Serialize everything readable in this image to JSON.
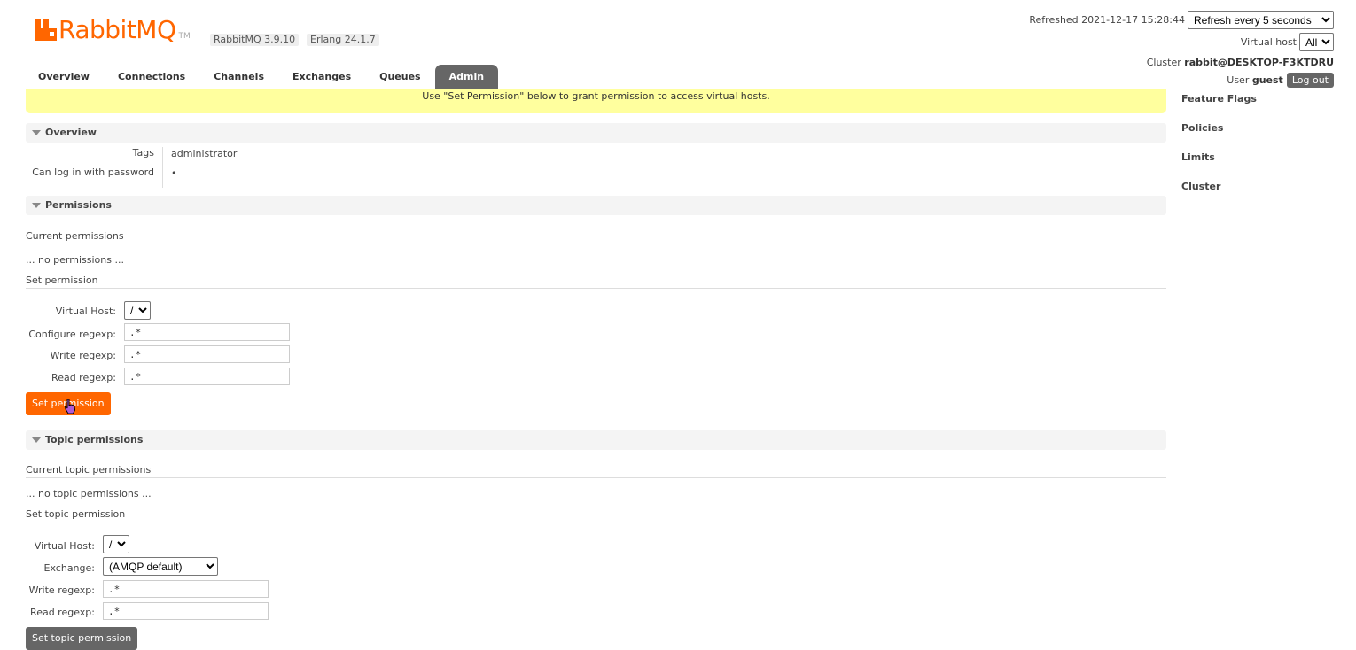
{
  "brand": {
    "logo_text": "RabbitMQ",
    "tm": "TM",
    "version": "RabbitMQ 3.9.10",
    "erlang": "Erlang 24.1.7",
    "accent": "#ff6600"
  },
  "header": {
    "refreshed_label": "Refreshed 2021-12-17 15:28:44",
    "refresh_select": "Refresh every 5 seconds",
    "vhost_label": "Virtual host",
    "vhost_select": "All",
    "cluster_label": "Cluster",
    "cluster_name": "rabbit@DESKTOP-F3KTDRU",
    "user_label": "User",
    "user_name": "guest",
    "logout": "Log out"
  },
  "tabs": [
    {
      "label": "Overview"
    },
    {
      "label": "Connections"
    },
    {
      "label": "Channels"
    },
    {
      "label": "Exchanges"
    },
    {
      "label": "Queues"
    },
    {
      "label": "Admin",
      "active": true
    }
  ],
  "rightnav": [
    "Feature Flags",
    "Policies",
    "Limits",
    "Cluster"
  ],
  "banner": "Use \"Set Permission\" below to grant permission to access virtual hosts.",
  "overview": {
    "title": "Overview",
    "tags_label": "Tags",
    "tags_value": "administrator",
    "login_label": "Can log in with password",
    "login_value": "•"
  },
  "permissions": {
    "title": "Permissions",
    "current_label": "Current permissions",
    "none": "... no permissions ...",
    "set_label": "Set permission",
    "vhost_label": "Virtual Host:",
    "vhost_value": "/",
    "configure_label": "Configure regexp:",
    "configure_value": ".*",
    "write_label": "Write regexp:",
    "write_value": ".*",
    "read_label": "Read regexp:",
    "read_value": ".*",
    "button": "Set permission"
  },
  "topic": {
    "title": "Topic permissions",
    "current_label": "Current topic permissions",
    "none": "... no topic permissions ...",
    "set_label": "Set topic permission",
    "vhost_label": "Virtual Host:",
    "vhost_value": "/",
    "exchange_label": "Exchange:",
    "exchange_value": "(AMQP default)",
    "write_label": "Write regexp:",
    "write_value": ".*",
    "read_label": "Read regexp:",
    "read_value": ".*",
    "button": "Set topic permission"
  }
}
